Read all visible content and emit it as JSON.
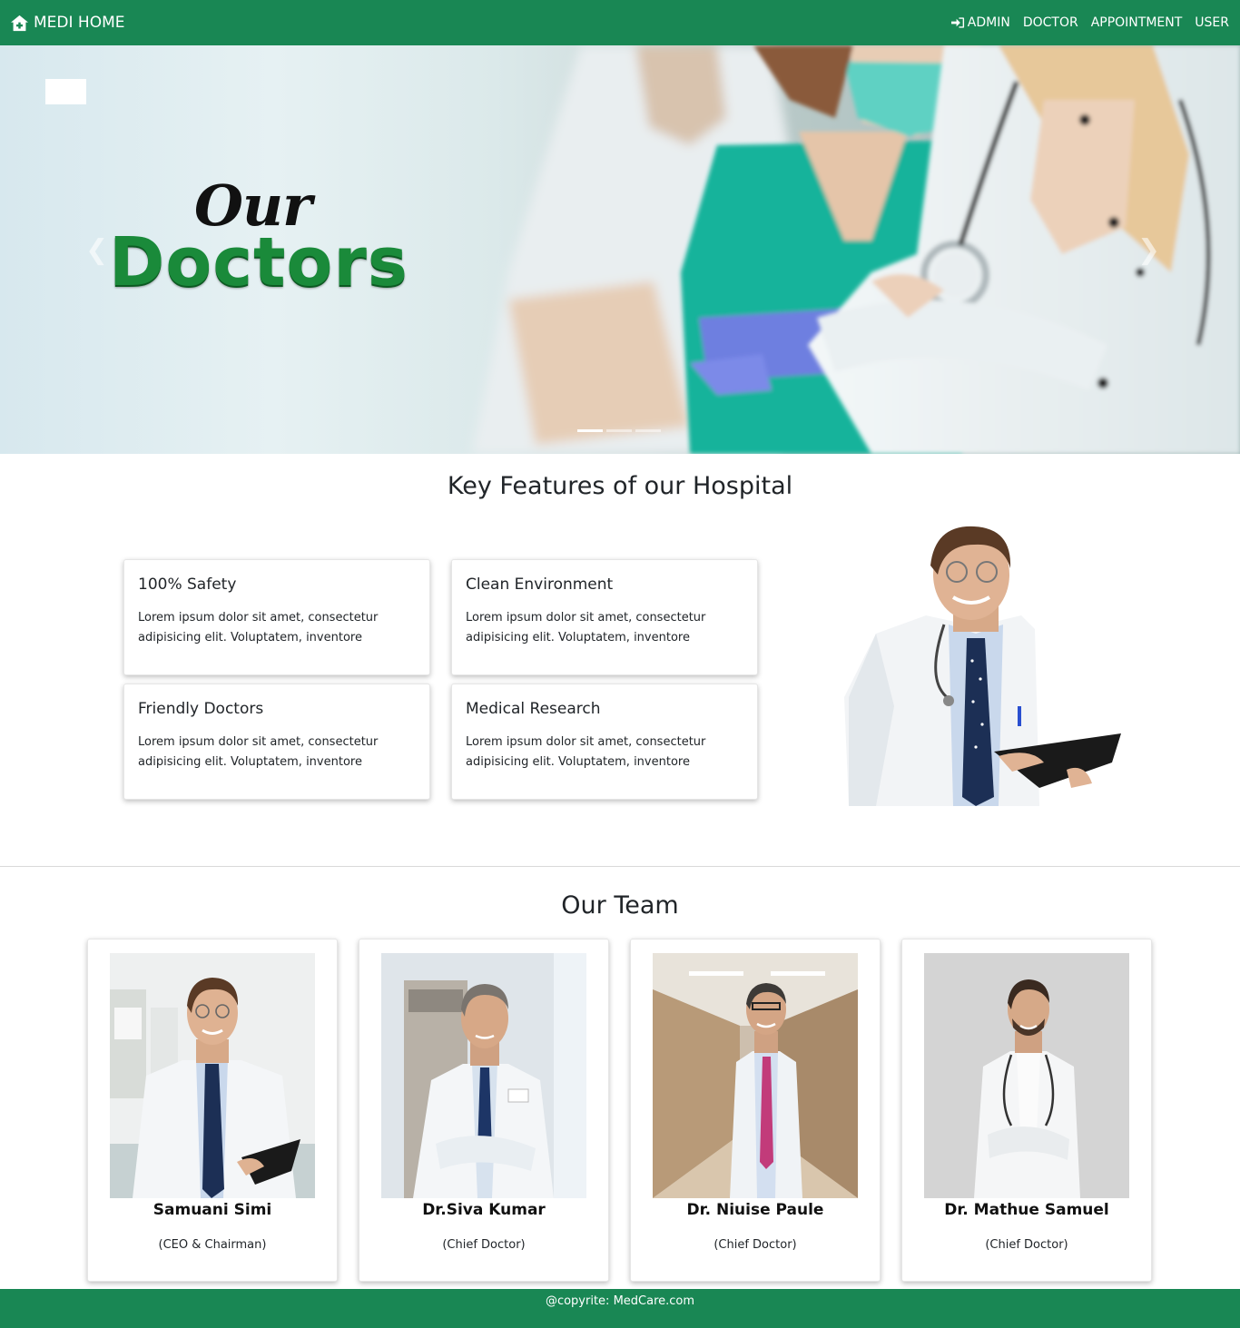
{
  "navbar": {
    "brand": "MEDI HOME",
    "brand_icon": "home-plus-icon",
    "links": [
      {
        "label": "ADMIN",
        "icon": "login-icon"
      },
      {
        "label": "DOCTOR"
      },
      {
        "label": "APPOINTMENT"
      },
      {
        "label": "USER"
      }
    ],
    "bg_color": "#198754"
  },
  "hero": {
    "title_line1": "Our",
    "title_line2": "Doctors",
    "prev_icon": "chevron-left-icon",
    "next_icon": "chevron-right-icon",
    "slides": 3,
    "active_slide": 1
  },
  "features": {
    "title": "Key Features of our Hospital",
    "items": [
      {
        "title": "100% Safety",
        "text": "Lorem ipsum dolor sit amet, consectetur adipisicing elit. Voluptatem, inventore"
      },
      {
        "title": "Clean Environment",
        "text": "Lorem ipsum dolor sit amet, consectetur adipisicing elit. Voluptatem, inventore"
      },
      {
        "title": "Friendly Doctors",
        "text": "Lorem ipsum dolor sit amet, consectetur adipisicing elit. Voluptatem, inventore"
      },
      {
        "title": "Medical Research",
        "text": "Lorem ipsum dolor sit amet, consectetur adipisicing elit. Voluptatem, inventore"
      }
    ]
  },
  "team": {
    "title": "Our Team",
    "members": [
      {
        "name": "Samuani Simi",
        "role": "(CEO & Chairman)"
      },
      {
        "name": "Dr.Siva Kumar",
        "role": "(Chief Doctor)"
      },
      {
        "name": "Dr. Niuise Paule",
        "role": "(Chief Doctor)"
      },
      {
        "name": "Dr. Mathue Samuel",
        "role": "(Chief Doctor)"
      }
    ]
  },
  "footer": {
    "text": "@copyrite: MedCare.com"
  }
}
